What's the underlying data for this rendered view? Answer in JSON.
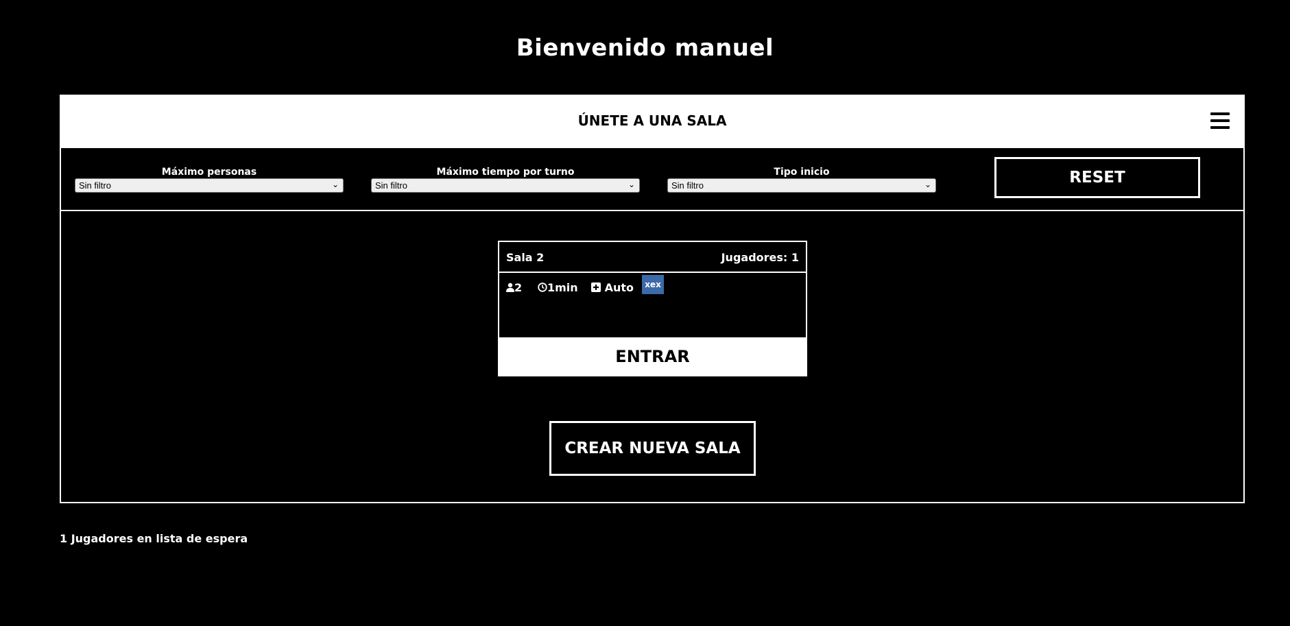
{
  "welcome": "Bienvenido manuel",
  "panel": {
    "title": "ÚNETE A UNA SALA",
    "menu_icon": "hamburger-menu-icon"
  },
  "filters": {
    "max_people": {
      "label": "Máximo personas",
      "value": "Sin filtro"
    },
    "max_time": {
      "label": "Máximo tiempo por turno",
      "value": "Sin filtro"
    },
    "start_type": {
      "label": "Tipo inicio",
      "value": "Sin filtro"
    },
    "reset_label": "RESET"
  },
  "room": {
    "name": "Sala 2",
    "players": "Jugadores: 1",
    "max_people": "2",
    "turn_time": "1min",
    "start_type": "Auto",
    "player_chip": "xex",
    "enter_label": "ENTRAR"
  },
  "create_label": "CREAR NUEVA SALA",
  "waiting": "1 Jugadores en lista de espera",
  "colors": {
    "background": "#000000",
    "accent": "#ffffff",
    "chip": "#3d6aa8"
  }
}
